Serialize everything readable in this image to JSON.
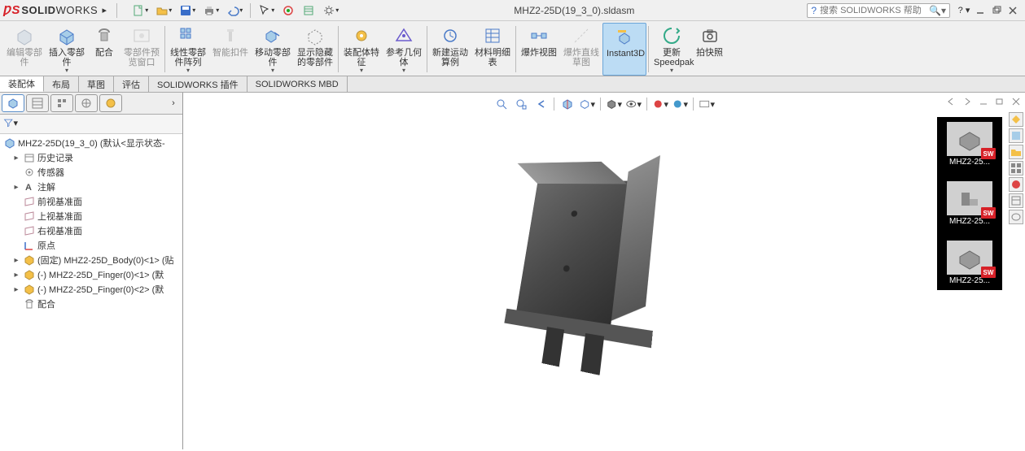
{
  "app": {
    "brand_solid": "SOLID",
    "brand_works": "WORKS",
    "document_title": "MHZ2-25D(19_3_0).sldasm",
    "search_placeholder": "搜索 SOLIDWORKS 帮助"
  },
  "ribbon": [
    {
      "id": "edit-part",
      "label": "编辑零部件"
    },
    {
      "id": "insert-part",
      "label": "插入零部件"
    },
    {
      "id": "mate",
      "label": "配合"
    },
    {
      "id": "part-preview",
      "label": "零部件预览窗口"
    },
    {
      "id": "linear-pattern",
      "label": "线性零部件阵列"
    },
    {
      "id": "smart-fastener",
      "label": "智能扣件"
    },
    {
      "id": "move-part",
      "label": "移动零部件"
    },
    {
      "id": "show-hidden",
      "label": "显示隐藏的零部件"
    },
    {
      "id": "assembly-features",
      "label": "装配体特征"
    },
    {
      "id": "reference-geom",
      "label": "参考几何体"
    },
    {
      "id": "new-motion",
      "label": "新建运动算例"
    },
    {
      "id": "bom",
      "label": "材料明细表"
    },
    {
      "id": "exploded-view",
      "label": "爆炸视图"
    },
    {
      "id": "explode-line",
      "label": "爆炸直线草图"
    },
    {
      "id": "instant3d",
      "label": "Instant3D"
    },
    {
      "id": "update-speedpak",
      "label": "更新Speedpak"
    },
    {
      "id": "snapshot",
      "label": "拍快照"
    }
  ],
  "tabs": [
    {
      "id": "assembly",
      "label": "装配体",
      "active": true
    },
    {
      "id": "layout",
      "label": "布局"
    },
    {
      "id": "sketch",
      "label": "草图"
    },
    {
      "id": "evaluate",
      "label": "评估"
    },
    {
      "id": "sw-addins",
      "label": "SOLIDWORKS 插件"
    },
    {
      "id": "sw-mbd",
      "label": "SOLIDWORKS MBD"
    }
  ],
  "tree": {
    "root": "MHZ2-25D(19_3_0)  (默认<显示状态-",
    "nodes": [
      {
        "label": "历史记录",
        "icon": "history",
        "expandable": true
      },
      {
        "label": "传感器",
        "icon": "sensor",
        "expandable": false
      },
      {
        "label": "注解",
        "icon": "annotation",
        "expandable": true
      },
      {
        "label": "前视基准面",
        "icon": "plane",
        "expandable": false
      },
      {
        "label": "上视基准面",
        "icon": "plane",
        "expandable": false
      },
      {
        "label": "右视基准面",
        "icon": "plane",
        "expandable": false
      },
      {
        "label": "原点",
        "icon": "origin",
        "expandable": false
      },
      {
        "label": "(固定) MHZ2-25D_Body(0)<1> (贴",
        "icon": "part",
        "expandable": true
      },
      {
        "label": "(-) MHZ2-25D_Finger(0)<1> (默",
        "icon": "part",
        "expandable": true
      },
      {
        "label": "(-) MHZ2-25D_Finger(0)<2> (默",
        "icon": "part",
        "expandable": true
      },
      {
        "label": "配合",
        "icon": "mates",
        "expandable": false
      }
    ]
  },
  "thumbnails": [
    {
      "label": "MHZ2-25..."
    },
    {
      "label": "MHZ2-25..."
    },
    {
      "label": "MHZ2-25..."
    }
  ]
}
